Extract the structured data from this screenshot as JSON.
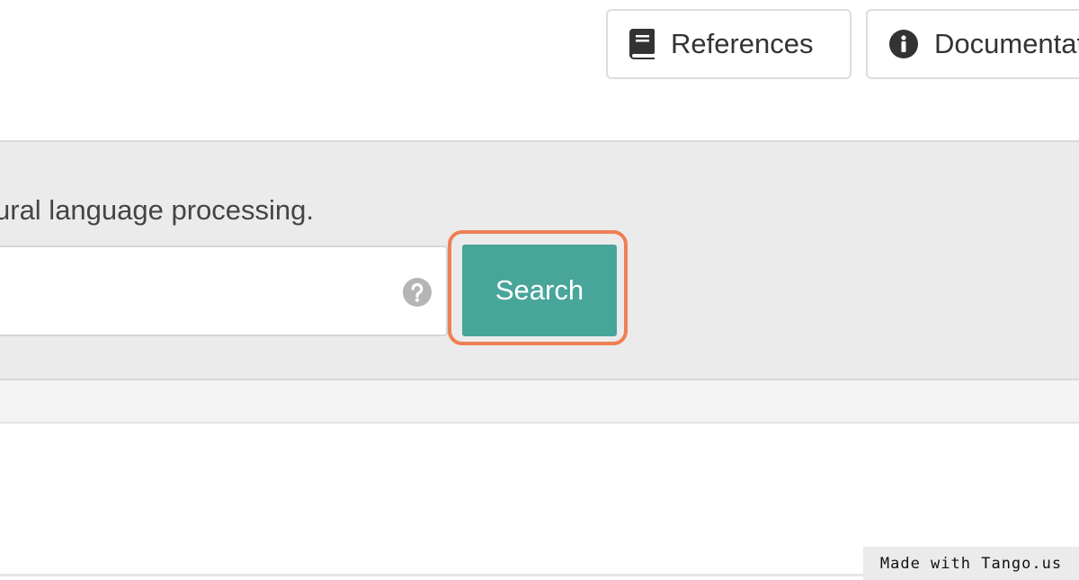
{
  "header": {
    "references_label": "References",
    "references_icon": "book-icon",
    "documentation_label": "Documentation",
    "documentation_icon": "info-icon"
  },
  "search": {
    "intro_text": "ural language processing.",
    "input_value": "",
    "help_icon": "question-circle-icon",
    "button_label": "Search",
    "button_color": "#48a59a",
    "highlight_color": "#ef7f55"
  },
  "watermark": {
    "text": "Made with Tango.us"
  }
}
